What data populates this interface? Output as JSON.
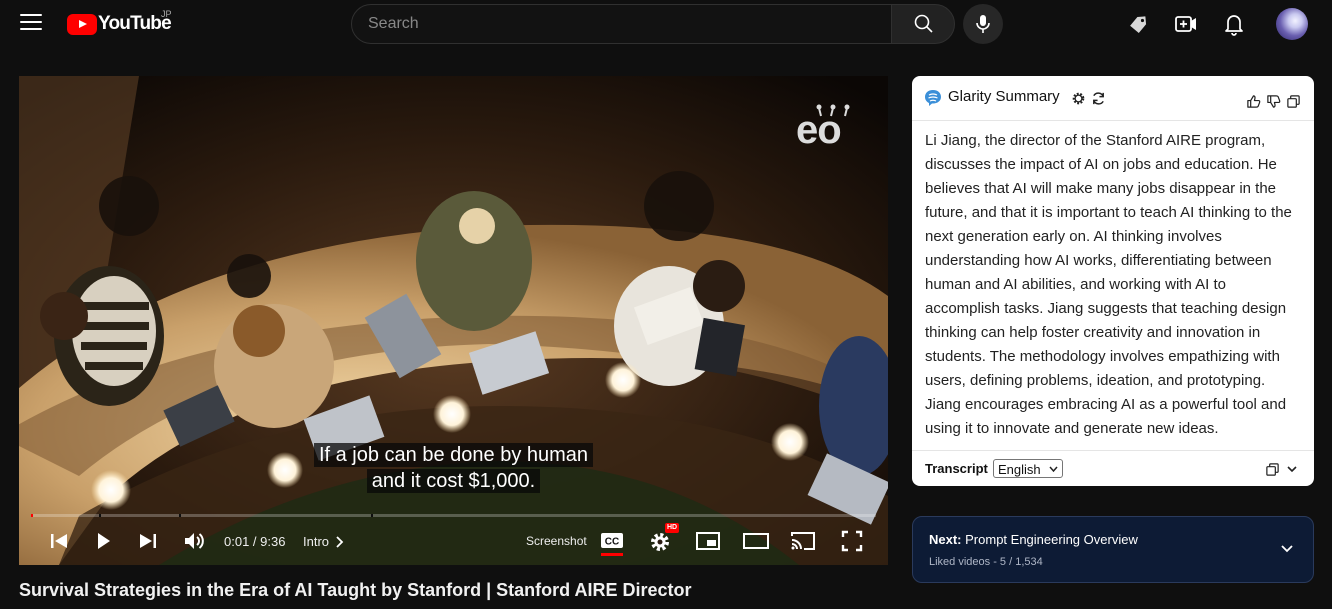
{
  "header": {
    "logo_text": "YouTube",
    "country": "JP",
    "search_placeholder": "Search"
  },
  "player": {
    "caption_line1": "If a job can be done by human",
    "caption_line2": "and it cost $1,000.",
    "watermark": "eo",
    "time": "0:01 / 9:36",
    "chapter": "Intro",
    "screenshot_label": "Screenshot",
    "hd_badge": "HD",
    "progress_fraction": 0.002
  },
  "video": {
    "title": "Survival Strategies in the Era of AI Taught by Stanford | Stanford AIRE Director"
  },
  "glarity": {
    "title": "Glarity Summary",
    "summary": "Li Jiang, the director of the Stanford AIRE program, discusses the impact of AI on jobs and education. He believes that AI will make many jobs disappear in the future, and that it is important to teach AI thinking to the next generation early on. AI thinking involves understanding how AI works, differentiating between human and AI abilities, and working with AI to accomplish tasks. Jiang suggests that teaching design thinking can help foster creativity and innovation in students. The methodology involves empathizing with users, defining problems, ideation, and prototyping. Jiang encourages embracing AI as a powerful tool and using it to innovate and generate new ideas.",
    "transcript_label": "Transcript",
    "language": "English"
  },
  "next": {
    "prefix": "Next:",
    "title": "Prompt Engineering Overview",
    "subtitle": "Liked videos - 5 / 1,534"
  },
  "colors": {
    "background": "#0f0f0f",
    "brand_red": "#ff0000",
    "next_card": "#0d1b35"
  }
}
